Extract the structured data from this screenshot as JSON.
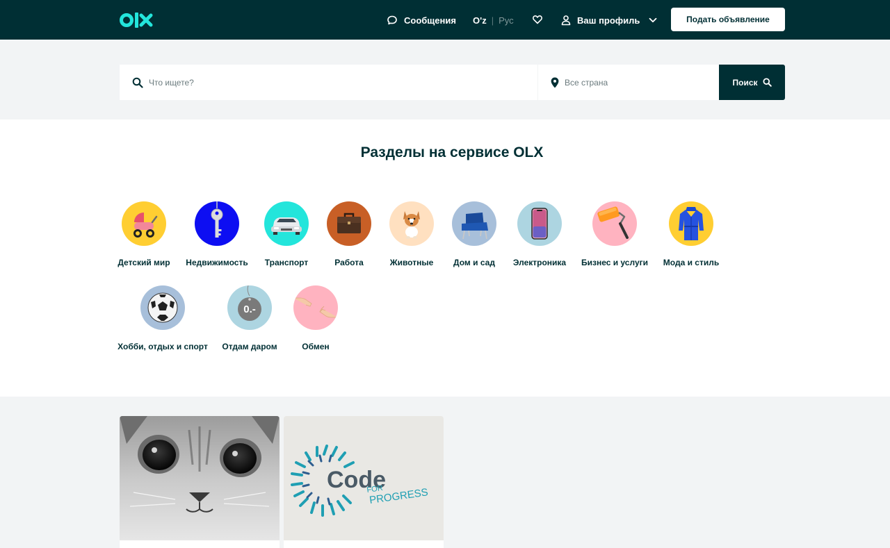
{
  "header": {
    "logo_text": "olx",
    "messages_label": "Сообщения",
    "lang_uz": "O'z",
    "lang_ru": "Рус",
    "profile_label": "Ваш профиль",
    "post_button": "Подать объявление"
  },
  "search": {
    "query_placeholder": "Что ищете?",
    "location_placeholder": "Все страна",
    "button_label": "Поиск"
  },
  "categories": {
    "title": "Разделы на сервисе OLX",
    "items": [
      {
        "label": "Детский мир",
        "icon": "stroller-icon",
        "bg": "#ffce32"
      },
      {
        "label": "Недвижимость",
        "icon": "key-icon",
        "bg": "#0d0ef2"
      },
      {
        "label": "Транспорт",
        "icon": "car-icon",
        "bg": "#23e5db"
      },
      {
        "label": "Работа",
        "icon": "briefcase-icon",
        "bg": "#c85f26"
      },
      {
        "label": "Животные",
        "icon": "dog-icon",
        "bg": "#ffe0c0"
      },
      {
        "label": "Дом и сад",
        "icon": "armchair-icon",
        "bg": "#a7bfda"
      },
      {
        "label": "Электроника",
        "icon": "smartphone-icon",
        "bg": "#add5e1"
      },
      {
        "label": "Бизнес и услуги",
        "icon": "paint-roller-icon",
        "bg": "#ffb3c0"
      },
      {
        "label": "Мода и стиль",
        "icon": "coat-icon",
        "bg": "#ffce32"
      },
      {
        "label": "Хобби, отдых и спорт",
        "icon": "soccer-ball-icon",
        "bg": "#a7bfda"
      },
      {
        "label": "Отдам даром",
        "icon": "price-tag-icon",
        "bg": "#add5e1"
      },
      {
        "label": "Обмен",
        "icon": "handshake-icon",
        "bg": "#ffb3c0"
      }
    ]
  },
  "cards": [
    {
      "image": "kitten-photo"
    },
    {
      "image": "code-for-progress-logo",
      "logo_word": "Code",
      "logo_for": "FOR",
      "logo_progress": "PROGRESS"
    }
  ],
  "colors": {
    "brand_dark": "#002f34",
    "brand_teal": "#23e5db",
    "background": "#f2f4f5"
  }
}
